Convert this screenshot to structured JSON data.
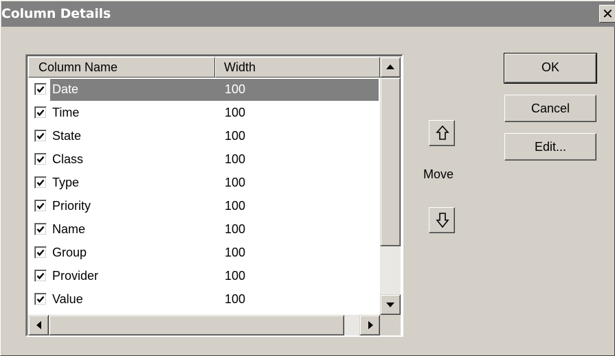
{
  "window": {
    "title": "Column Details",
    "close_glyph": "✕"
  },
  "list": {
    "headers": {
      "name": "Column Name",
      "width": "Width"
    },
    "selected_index": 0,
    "rows": [
      {
        "name": "Date",
        "width": "100",
        "checked": true
      },
      {
        "name": "Time",
        "width": "100",
        "checked": true
      },
      {
        "name": "State",
        "width": "100",
        "checked": true
      },
      {
        "name": "Class",
        "width": "100",
        "checked": true
      },
      {
        "name": "Type",
        "width": "100",
        "checked": true
      },
      {
        "name": "Priority",
        "width": "100",
        "checked": true
      },
      {
        "name": "Name",
        "width": "100",
        "checked": true
      },
      {
        "name": "Group",
        "width": "100",
        "checked": true
      },
      {
        "name": "Provider",
        "width": "100",
        "checked": true
      },
      {
        "name": "Value",
        "width": "100",
        "checked": true
      }
    ]
  },
  "buttons": {
    "ok": "OK",
    "cancel": "Cancel",
    "edit": "Edit..."
  },
  "move": {
    "label": "Move",
    "up_icon": "arrow-up-icon",
    "down_icon": "arrow-down-icon"
  },
  "colors": {
    "face": "#d4d0c8",
    "titlebar": "#808080",
    "selection": "#808080"
  }
}
